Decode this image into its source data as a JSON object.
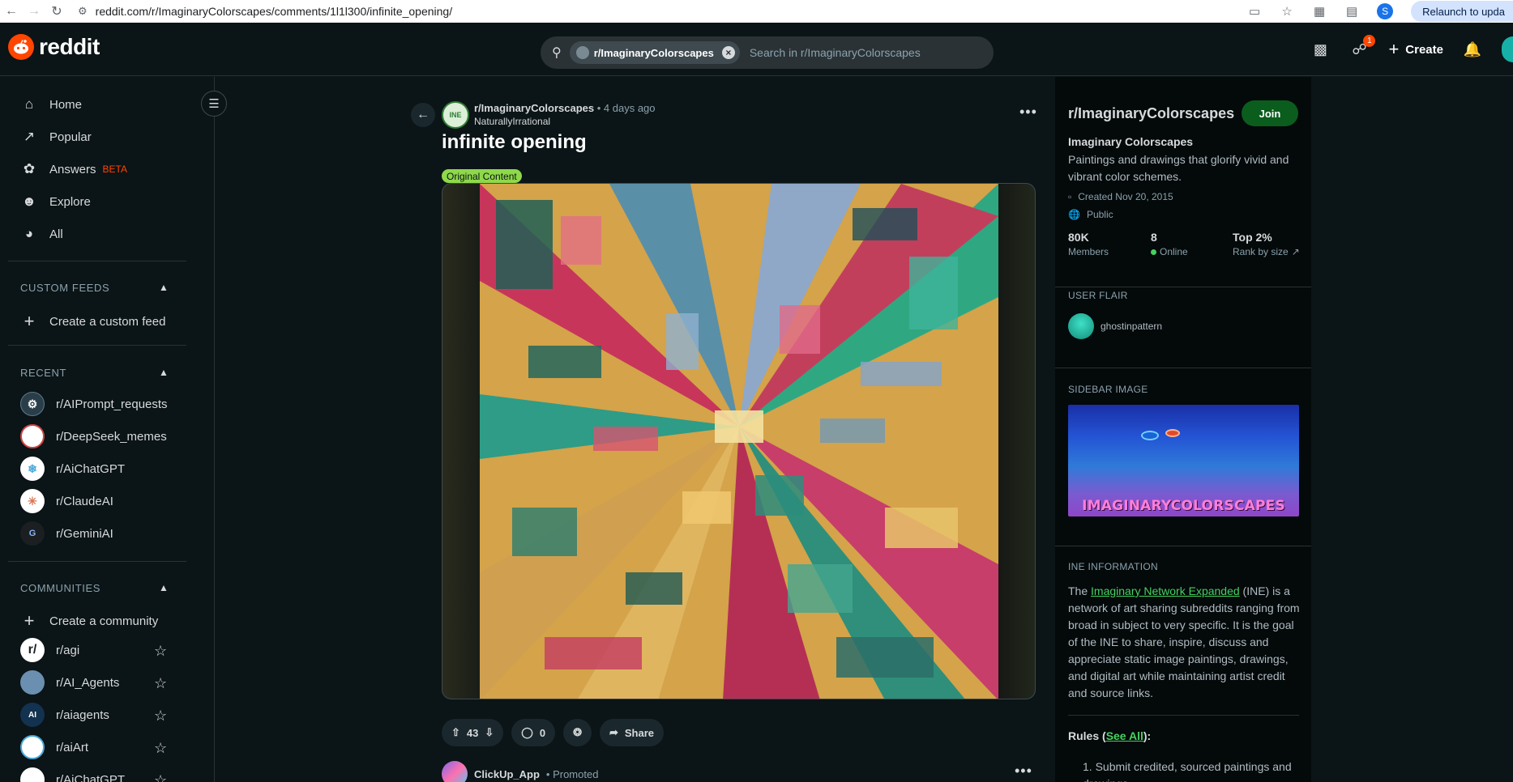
{
  "browser": {
    "url": "reddit.com/r/ImaginaryColorscapes/comments/1l1l300/infinite_opening/",
    "profile_initial": "S",
    "relaunch_label": "Relaunch to upda"
  },
  "header": {
    "logo_text": "reddit",
    "search_chip": "r/ImaginaryColorscapes",
    "search_placeholder": "Search in r/ImaginaryColorscapes",
    "chat_badge": "1",
    "create_label": "Create"
  },
  "sidebar": {
    "nav": [
      {
        "label": "Home",
        "icon": "home-icon"
      },
      {
        "label": "Popular",
        "icon": "popular-icon"
      },
      {
        "label": "Answers",
        "icon": "answers-icon",
        "tag": "BETA"
      },
      {
        "label": "Explore",
        "icon": "explore-icon"
      },
      {
        "label": "All",
        "icon": "all-icon"
      }
    ],
    "custom_feeds_heading": "CUSTOM FEEDS",
    "create_feed_label": "Create a custom feed",
    "recent_heading": "RECENT",
    "recent": [
      {
        "name": "r/AIPrompt_requests",
        "color": "#2a3e4a"
      },
      {
        "name": "r/DeepSeek_memes",
        "color": "#ffffff"
      },
      {
        "name": "r/AiChatGPT",
        "color": "#ffffff"
      },
      {
        "name": "r/ClaudeAI",
        "color": "#ffffff"
      },
      {
        "name": "r/GeminiAI",
        "color": "#1b1f22"
      }
    ],
    "communities_heading": "COMMUNITIES",
    "create_community_label": "Create a community",
    "communities": [
      {
        "name": "r/agi",
        "avatar_text": "r/",
        "color": "#ffffff"
      },
      {
        "name": "r/AI_Agents",
        "avatar_text": "",
        "color": "#6a8fb0"
      },
      {
        "name": "r/aiagents",
        "avatar_text": "AI",
        "color": "#12324f"
      },
      {
        "name": "r/aiArt",
        "avatar_text": "",
        "color": "#ffffff"
      },
      {
        "name": "r/AiChatGPT",
        "avatar_text": "",
        "color": "#ffffff"
      }
    ]
  },
  "post": {
    "subreddit": "r/ImaginaryColorscapes",
    "subreddit_avatar_text": "INE",
    "time": "• 4 days ago",
    "author": "NaturallyIrrational",
    "title": "infinite opening",
    "flair": "Original Content",
    "votes": "43",
    "comments": "0",
    "share_label": "Share"
  },
  "promoted": {
    "name": "ClickUp_App",
    "tag": "• Promoted"
  },
  "community": {
    "title": "r/ImaginaryColorscapes",
    "join_label": "Join",
    "name": "Imaginary Colorscapes",
    "description": "Paintings and drawings that glorify vivid and vibrant color schemes.",
    "created": "Created Nov 20, 2015",
    "visibility": "Public",
    "stats": [
      {
        "value": "80K",
        "label": "Members"
      },
      {
        "value": "8",
        "label": "Online"
      },
      {
        "value": "Top 2%",
        "label": "Rank by size"
      }
    ],
    "user_flair_heading": "USER FLAIR",
    "user_flair_name": "ghostinpattern",
    "sidebar_image_heading": "SIDEBAR IMAGE",
    "sidebar_image_text": "IMAGINARYCOLORSCAPES",
    "ine_heading": "INE INFORMATION",
    "ine_text_prefix": "The ",
    "ine_link": "Imaginary Network Expanded",
    "ine_text_suffix": " (INE) is a network of art sharing subreddits ranging from broad in subject to very specific. It is the goal of the INE to share, inspire, discuss and appreciate static image paintings, drawings, and digital art while maintaining artist credit and source links.",
    "rules_label": "Rules (",
    "rules_link": "See All",
    "rules_suffix": "):",
    "rule_1": "Submit credited, sourced paintings and drawings"
  }
}
